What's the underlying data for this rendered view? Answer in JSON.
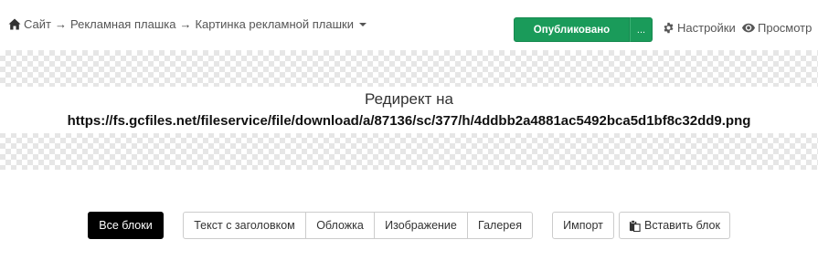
{
  "breadcrumb": {
    "items": [
      "Сайт",
      "Рекламная плашка",
      "Картинка рекламной плашки"
    ],
    "separator": "→"
  },
  "header": {
    "publish_label": "Опубликовано",
    "more_label": "...",
    "settings_label": "Настройки",
    "preview_label": "Просмотр"
  },
  "redirect": {
    "title": "Редирект на",
    "url": "https://fs.gcfiles.net/fileservice/file/download/a/87136/sc/377/h/4ddbb2a4881ac5492bca5d1bf8c32dd9.png"
  },
  "toolbar": {
    "all_blocks": "Все блоки",
    "categories": [
      "Текст с заголовком",
      "Обложка",
      "Изображение",
      "Галерея"
    ],
    "import_label": "Импорт",
    "paste_label": "Вставить блок"
  },
  "colors": {
    "publish_green": "#1a9b5a",
    "active_black": "#000000"
  },
  "icons": {
    "home": "home-icon",
    "settings": "gear-icon",
    "preview": "eye-icon",
    "paste": "clipboard-icon",
    "dropdown": "caret-down-icon"
  }
}
